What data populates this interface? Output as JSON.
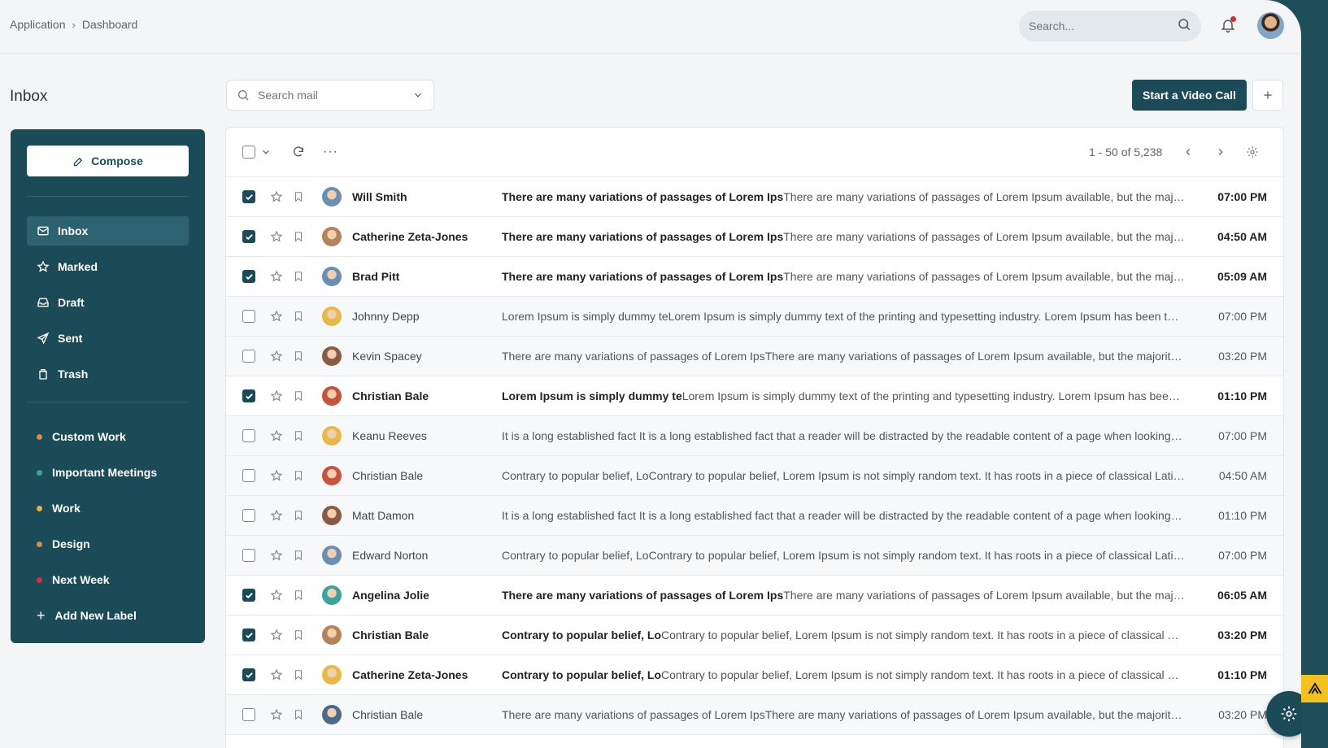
{
  "breadcrumb": {
    "root": "Application",
    "current": "Dashboard"
  },
  "top_search": {
    "placeholder": "Search..."
  },
  "page_title": "Inbox",
  "sidebar": {
    "compose_label": "Compose",
    "nav": [
      {
        "label": "Inbox",
        "icon": "mail-icon",
        "active": true
      },
      {
        "label": "Marked",
        "icon": "star-icon"
      },
      {
        "label": "Draft",
        "icon": "inbox-tray-icon"
      },
      {
        "label": "Sent",
        "icon": "send-icon"
      },
      {
        "label": "Trash",
        "icon": "trash-icon"
      }
    ],
    "labels": [
      {
        "label": "Custom Work",
        "color": "#e08a3c"
      },
      {
        "label": "Important Meetings",
        "color": "#3aa3a0"
      },
      {
        "label": "Work",
        "color": "#f0a93a"
      },
      {
        "label": "Design",
        "color": "#e08a3c"
      },
      {
        "label": "Next Week",
        "color": "#d6303a"
      }
    ],
    "add_label": "Add New Label"
  },
  "mail_search": {
    "placeholder": "Search mail"
  },
  "actions": {
    "video_call": "Start a Video Call"
  },
  "pager": {
    "range": "1 - 50 of 5,238"
  },
  "emails": [
    {
      "sender": "Will Smith",
      "subject": "There are many variations of passages of Lorem Ips",
      "preview": "There are many variations of passages of Lorem Ipsum available, but the majority have suffered alteration in some form",
      "time": "07:00 PM",
      "checked": true,
      "unread": true,
      "avatar_color": "#6b8fb4"
    },
    {
      "sender": "Catherine Zeta-Jones",
      "subject": "There are many variations of passages of Lorem Ips",
      "preview": "There are many variations of passages of Lorem Ipsum available, but the majority have suffered alteration in some form",
      "time": "04:50 AM",
      "checked": true,
      "unread": true,
      "avatar_color": "#b5835a"
    },
    {
      "sender": "Brad Pitt",
      "subject": "There are many variations of passages of Lorem Ips",
      "preview": "There are many variations of passages of Lorem Ipsum available, but the majority have suffered alteration in some form",
      "time": "05:09 AM",
      "checked": true,
      "unread": true,
      "avatar_color": "#6b8fb4"
    },
    {
      "sender": "Johnny Depp",
      "subject": "Lorem Ipsum is simply dummy te",
      "preview": "Lorem Ipsum is simply dummy text of the printing and typesetting industry. Lorem Ipsum has been the industry's standard",
      "time": "07:00 PM",
      "checked": false,
      "unread": false,
      "avatar_color": "#e7b84a"
    },
    {
      "sender": "Kevin Spacey",
      "subject": "There are many variations of passages of Lorem Ips",
      "preview": "There are many variations of passages of Lorem Ipsum available, but the majority have suffered alteration in some form",
      "time": "03:20 PM",
      "checked": false,
      "unread": false,
      "avatar_color": "#8a5a44"
    },
    {
      "sender": "Christian Bale",
      "subject": "Lorem Ipsum is simply dummy te",
      "preview": "Lorem Ipsum is simply dummy text of the printing and typesetting industry. Lorem Ipsum has been the industry's standard",
      "time": "01:10 PM",
      "checked": true,
      "unread": true,
      "avatar_color": "#c9523f"
    },
    {
      "sender": "Keanu Reeves",
      "subject": "It is a long established fact ",
      "preview": "It is a long established fact that a reader will be distracted by the readable content of a page when looking at its layout",
      "time": "07:00 PM",
      "checked": false,
      "unread": false,
      "avatar_color": "#e7b84a"
    },
    {
      "sender": "Christian Bale",
      "subject": "Contrary to popular belief, Lo",
      "preview": "Contrary to popular belief, Lorem Ipsum is not simply random text. It has roots in a piece of classical Latin literature",
      "time": "04:50 AM",
      "checked": false,
      "unread": false,
      "avatar_color": "#c9523f"
    },
    {
      "sender": "Matt Damon",
      "subject": "It is a long established fact ",
      "preview": "It is a long established fact that a reader will be distracted by the readable content of a page when looking at its layout",
      "time": "01:10 PM",
      "checked": false,
      "unread": false,
      "avatar_color": "#8a5a44"
    },
    {
      "sender": "Edward Norton",
      "subject": "Contrary to popular belief, Lo",
      "preview": "Contrary to popular belief, Lorem Ipsum is not simply random text. It has roots in a piece of classical Latin literature",
      "time": "07:00 PM",
      "checked": false,
      "unread": false,
      "avatar_color": "#6b8fb4"
    },
    {
      "sender": "Angelina Jolie",
      "subject": "There are many variations of passages of Lorem Ips",
      "preview": "There are many variations of passages of Lorem Ipsum available, but the majority have suffered alteration in some form",
      "time": "06:05 AM",
      "checked": true,
      "unread": true,
      "avatar_color": "#3aa3a0"
    },
    {
      "sender": "Christian Bale",
      "subject": "Contrary to popular belief, Lo",
      "preview": "Contrary to popular belief, Lorem Ipsum is not simply random text. It has roots in a piece of classical Latin literature",
      "time": "03:20 PM",
      "checked": true,
      "unread": true,
      "avatar_color": "#b5835a"
    },
    {
      "sender": "Catherine Zeta-Jones",
      "subject": "Contrary to popular belief, Lo",
      "preview": "Contrary to popular belief, Lorem Ipsum is not simply random text. It has roots in a piece of classical Latin literature",
      "time": "01:10 PM",
      "checked": true,
      "unread": true,
      "avatar_color": "#e7b84a"
    },
    {
      "sender": "Christian Bale",
      "subject": "There are many variations of passages of Lorem Ips",
      "preview": "There are many variations of passages of Lorem Ipsum available, but the majority have suffered alteration in some form",
      "time": "03:20 PM",
      "checked": false,
      "unread": false,
      "avatar_color": "#4a6a8a"
    }
  ]
}
